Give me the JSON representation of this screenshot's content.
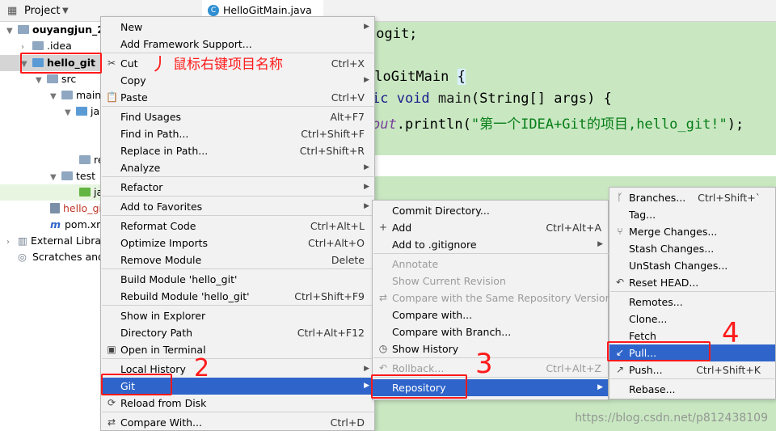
{
  "project_panel": {
    "title": "Project",
    "tree": [
      {
        "label": "ouyangjun_2",
        "bold": true
      },
      {
        "label": ".idea"
      },
      {
        "label": "hello_git",
        "bold": true
      },
      {
        "label": "src"
      },
      {
        "label": "main"
      },
      {
        "label": "ja"
      },
      {
        "label": "re"
      },
      {
        "label": "test"
      },
      {
        "label": "ja"
      },
      {
        "label": "hello_gi"
      },
      {
        "label": "pom.xm"
      },
      {
        "label": "External Libra"
      },
      {
        "label": "Scratches and"
      }
    ]
  },
  "editor": {
    "tab_label": "HelloGitMain.java",
    "code": {
      "l1": "logit;",
      "l2a": "lloGitMain ",
      "l2b": "{",
      "l3a": "ic void ",
      "l3b": "main",
      "l3c": "(String[] args) {",
      "l4a": "out",
      "l4b": ".println(",
      "l4c": "\"第一个IDEA+Git的项目,hello_git!\"",
      "l4d": ");"
    }
  },
  "context_menu": {
    "items": [
      {
        "label": "New",
        "shortcut": "",
        "submenu": true
      },
      {
        "label": "Add Framework Support...",
        "shortcut": ""
      },
      {
        "label": "Cut",
        "shortcut": "Ctrl+X",
        "icon": "✂"
      },
      {
        "label": "Copy",
        "shortcut": "",
        "submenu": true
      },
      {
        "label": "Paste",
        "shortcut": "Ctrl+V",
        "icon": "📋"
      },
      {
        "label": "Find Usages",
        "shortcut": "Alt+F7"
      },
      {
        "label": "Find in Path...",
        "shortcut": "Ctrl+Shift+F"
      },
      {
        "label": "Replace in Path...",
        "shortcut": "Ctrl+Shift+R"
      },
      {
        "label": "Analyze",
        "shortcut": "",
        "submenu": true
      },
      {
        "label": "Refactor",
        "shortcut": "",
        "submenu": true
      },
      {
        "label": "Add to Favorites",
        "shortcut": "",
        "submenu": true
      },
      {
        "label": "Reformat Code",
        "shortcut": "Ctrl+Alt+L"
      },
      {
        "label": "Optimize Imports",
        "shortcut": "Ctrl+Alt+O"
      },
      {
        "label": "Remove Module",
        "shortcut": "Delete"
      },
      {
        "label": "Build Module 'hello_git'",
        "shortcut": ""
      },
      {
        "label": "Rebuild Module 'hello_git'",
        "shortcut": "Ctrl+Shift+F9"
      },
      {
        "label": "Show in Explorer",
        "shortcut": ""
      },
      {
        "label": "Directory Path",
        "shortcut": "Ctrl+Alt+F12"
      },
      {
        "label": "Open in Terminal",
        "shortcut": "",
        "icon": "▣"
      },
      {
        "label": "Local History",
        "shortcut": "",
        "submenu": true
      },
      {
        "label": "Git",
        "shortcut": "",
        "submenu": true,
        "selected": true
      },
      {
        "label": "Reload from Disk",
        "shortcut": "",
        "icon": "⟳"
      },
      {
        "label": "Compare With...",
        "shortcut": "Ctrl+D",
        "icon": "⇄"
      }
    ]
  },
  "git_menu": {
    "items": [
      {
        "label": "Commit Directory...",
        "shortcut": ""
      },
      {
        "label": "Add",
        "shortcut": "Ctrl+Alt+A",
        "icon": "+"
      },
      {
        "label": "Add to .gitignore",
        "shortcut": "",
        "submenu": true
      },
      {
        "label": "Annotate",
        "shortcut": "",
        "disabled": true
      },
      {
        "label": "Show Current Revision",
        "shortcut": "",
        "disabled": true
      },
      {
        "label": "Compare with the Same Repository Version",
        "shortcut": "",
        "disabled": true,
        "icon": "⇄"
      },
      {
        "label": "Compare with...",
        "shortcut": ""
      },
      {
        "label": "Compare with Branch...",
        "shortcut": ""
      },
      {
        "label": "Show History",
        "shortcut": "",
        "icon": "◷"
      },
      {
        "label": "Rollback...",
        "shortcut": "Ctrl+Alt+Z",
        "disabled": true,
        "icon": "↶"
      },
      {
        "label": "Repository",
        "shortcut": "",
        "submenu": true,
        "selected": true
      }
    ]
  },
  "repo_menu": {
    "items": [
      {
        "label": "Branches...",
        "shortcut": "Ctrl+Shift+`",
        "icon": "ᚴ"
      },
      {
        "label": "Tag...",
        "shortcut": ""
      },
      {
        "label": "Merge Changes...",
        "shortcut": "",
        "icon": "⑂"
      },
      {
        "label": "Stash Changes...",
        "shortcut": ""
      },
      {
        "label": "UnStash Changes...",
        "shortcut": ""
      },
      {
        "label": "Reset HEAD...",
        "shortcut": "",
        "icon": "↶"
      },
      {
        "label": "Remotes...",
        "shortcut": ""
      },
      {
        "label": "Clone...",
        "shortcut": ""
      },
      {
        "label": "Fetch",
        "shortcut": ""
      },
      {
        "label": "Pull...",
        "shortcut": "",
        "selected": true,
        "icon": "↙"
      },
      {
        "label": "Push...",
        "shortcut": "Ctrl+Shift+K",
        "icon": "↗"
      },
      {
        "label": "Rebase...",
        "shortcut": ""
      }
    ]
  },
  "annotations": {
    "step1_mark": "丿",
    "step1_text": "鼠标右键项目名称",
    "step2": "2",
    "step3": "3",
    "step4": "4",
    "color": "#ff1a1a"
  },
  "watermark": "https://blog.csdn.net/p812438109"
}
